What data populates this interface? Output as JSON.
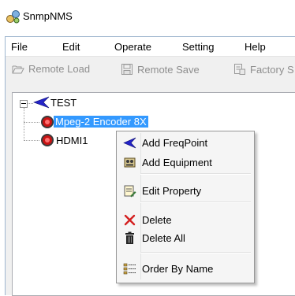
{
  "window": {
    "title": "SnmpNMS"
  },
  "menubar": {
    "items": [
      "File",
      "Edit",
      "Operate",
      "Setting",
      "Help"
    ]
  },
  "toolbar": {
    "remote_load": "Remote Load",
    "remote_save": "Remote Save",
    "factory": "Factory S"
  },
  "tree": {
    "root": "TEST",
    "children": [
      "Mpeg-2 Encoder 8X",
      "HDMI1"
    ]
  },
  "context_menu": {
    "items": [
      "Add FreqPoint",
      "Add Equipment",
      "Edit Property",
      "Delete",
      "Delete All",
      "Order By Name"
    ]
  },
  "colors": {
    "selection": "#3399ff",
    "arrow_blue": "#2323c8",
    "delete_red": "#d42020",
    "node_red": "#c81414"
  }
}
